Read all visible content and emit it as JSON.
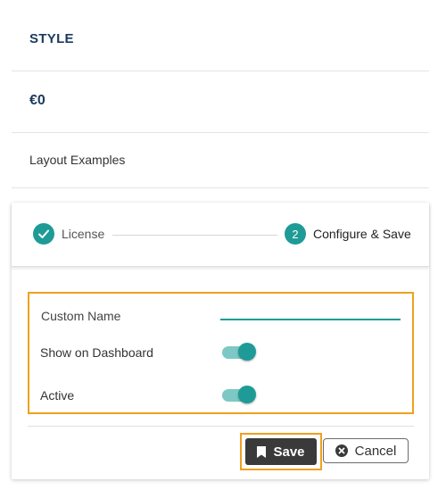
{
  "info": {
    "style": "STYLE",
    "price": "€0",
    "layout_examples": "Layout Examples"
  },
  "stepper": {
    "steps": [
      {
        "label": "License",
        "state": "completed",
        "icon": "check-icon"
      },
      {
        "label": "Configure & Save",
        "state": "active",
        "number": "2"
      }
    ]
  },
  "form": {
    "custom_name_label": "Custom Name",
    "custom_name_value": "",
    "show_on_dashboard_label": "Show on Dashboard",
    "show_on_dashboard_on": true,
    "active_label": "Active",
    "active_on": true
  },
  "actions": {
    "save_label": "Save",
    "save_icon": "bookmark-icon",
    "cancel_label": "Cancel",
    "cancel_icon": "close-circle-icon"
  },
  "colors": {
    "accent": "#1e9b97",
    "highlight": "#f0a020",
    "heading": "#1b3a5c",
    "save_bg": "#3a3a3a"
  }
}
